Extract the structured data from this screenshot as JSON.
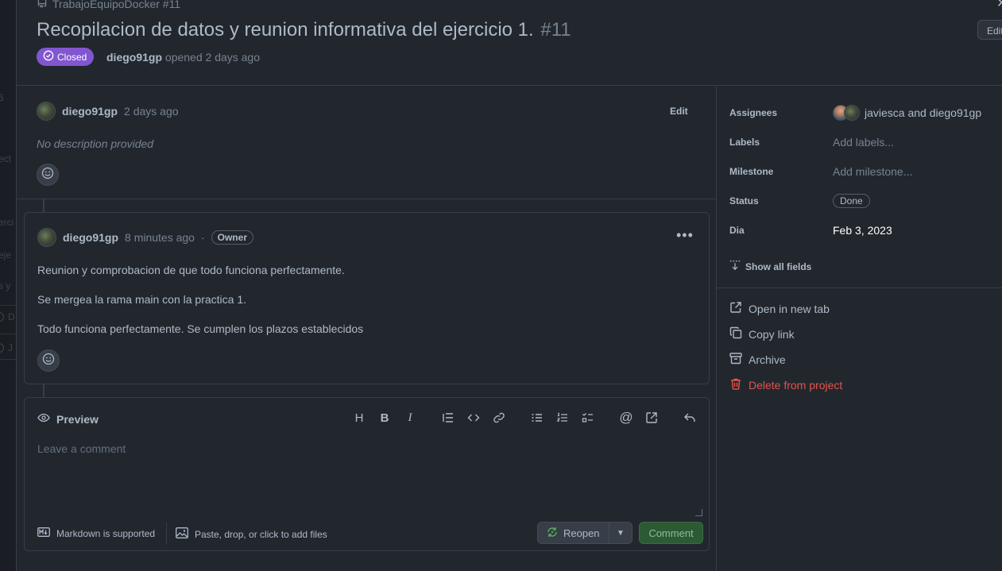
{
  "header": {
    "repo": "TrabajoEquipoDocker #11",
    "title": "Recopilacion de datos y reunion informativa del ejercicio 1.",
    "number": "#11",
    "status_badge": "Closed",
    "author": "diego91gp",
    "opened_text": "opened 2 days ago",
    "edit_label": "Edit"
  },
  "backdrop": {
    "fragments": [
      "6",
      "ect",
      "erci",
      "eje",
      "s y",
      "D",
      "J"
    ]
  },
  "description": {
    "author": "diego91gp",
    "time": "2 days ago",
    "edit_label": "Edit",
    "body": "No description provided"
  },
  "comment": {
    "author": "diego91gp",
    "time": "8 minutes ago",
    "separator": "·",
    "role": "Owner",
    "paragraphs": [
      "Reunion y comprobacion de que todo funciona perfectamente.",
      "Se mergea la rama main con la practica 1.",
      "Todo funciona perfectamente. Se cumplen los plazos establecidos"
    ]
  },
  "editor": {
    "tab_label": "Preview",
    "placeholder": "Leave a comment",
    "markdown_note": "Markdown is supported",
    "files_note": "Paste, drop, or click to add files",
    "reopen_label": "Reopen",
    "comment_label": "Comment",
    "toolbar": [
      {
        "icon": "heading-icon",
        "glyph": "H"
      },
      {
        "icon": "bold-icon",
        "glyph": "B"
      },
      {
        "icon": "italic-icon",
        "glyph": "I"
      },
      {
        "icon": "quote-icon",
        "glyph": "❝"
      },
      {
        "icon": "code-icon",
        "glyph": "<>"
      },
      {
        "icon": "link-icon",
        "glyph": "🔗"
      },
      {
        "icon": "unordered-list-icon",
        "glyph": "≔"
      },
      {
        "icon": "ordered-list-icon",
        "glyph": "≔"
      },
      {
        "icon": "task-list-icon",
        "glyph": "☑"
      },
      {
        "icon": "mention-icon",
        "glyph": "@"
      },
      {
        "icon": "cross-reference-icon",
        "glyph": "↗"
      },
      {
        "icon": "reply-icon",
        "glyph": "↩"
      }
    ]
  },
  "sidebar": {
    "assignees_label": "Assignees",
    "assignees_value": "javiesca and diego91gp",
    "labels_label": "Labels",
    "labels_value": "Add labels...",
    "milestone_label": "Milestone",
    "milestone_value": "Add milestone...",
    "status_label": "Status",
    "status_value": "Done",
    "dia_label": "Dia",
    "dia_value": "Feb 3, 2023",
    "show_all": "Show all fields",
    "actions": {
      "open_tab": "Open in new tab",
      "copy_link": "Copy link",
      "archive": "Archive",
      "delete": "Delete from project"
    }
  },
  "colors": {
    "closed_badge": "#8256d0",
    "comment_button": "#2c5a35",
    "danger": "#e5534b",
    "background": "#22272e"
  }
}
